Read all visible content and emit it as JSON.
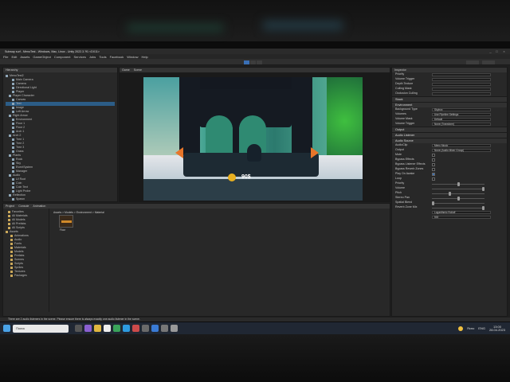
{
  "window": {
    "title": "Subway surf - MenuTest - Windows, Mac, Linux - Unity 2022.3.?f1 <DX11>"
  },
  "menu": [
    "File",
    "Edit",
    "Assets",
    "GameObject",
    "Component",
    "Services",
    "Jobs",
    "Tools",
    "Facebook",
    "Window",
    "Help"
  ],
  "hierarchy": {
    "tab": "Hierarchy",
    "rows": [
      "MenuTest2",
      "Main Camera",
      "Camera",
      "Directional Light",
      "Player",
      "Player Character",
      "Canvas",
      "Text",
      "Image",
      "Left Arrow",
      "Right Arrow",
      "Environment",
      "Floor 1",
      "Floor 2",
      "Arch 1",
      "Arch 2",
      "Tree 1",
      "Tree 2",
      "Tree 3",
      "Grass",
      "Plants",
      "Rock",
      "Sky",
      "EventSystem",
      "Manager",
      "Audio",
      "UI Root",
      "Coin",
      "Coin Text",
      "Light Probe",
      "Reflection",
      "Spawn"
    ]
  },
  "scene_tabs": [
    "Game",
    "Scene"
  ],
  "project": {
    "tabs": [
      "Project",
      "Console",
      "Animation"
    ],
    "breadcrumb": "Assets > Models > Environment > Material",
    "folders": [
      "Favorites",
      "All Materials",
      "All Models",
      "All Prefabs",
      "All Scripts",
      "Assets",
      "Animations",
      "Audio",
      "Fonts",
      "Materials",
      "Models",
      "Prefabs",
      "Scenes",
      "Scripts",
      "Sprites",
      "Textures",
      "Packages"
    ],
    "asset_label": "Floor"
  },
  "game": {
    "coin_value": "90$"
  },
  "inspector": {
    "tab": "Inspector",
    "top_rows": [
      "Priority",
      "Volume Trigger",
      "Depth Texture",
      "Culling Mask",
      "Occlusion Culling"
    ],
    "sections": [
      "Stack",
      "Environment",
      "Output",
      "Audio Listener",
      "Audio Source"
    ],
    "env_rows": [
      "Background Type",
      "Volumes",
      "Volume Mask",
      "Volume Trigger"
    ],
    "env_values": [
      "Skybox",
      "Use Pipeline Settings",
      "Default",
      "None (Transform)"
    ],
    "audio_rows": [
      "AudioClip",
      "Output",
      "Mute",
      "Bypass Effects",
      "Bypass Listener Effects",
      "Bypass Reverb Zones",
      "Play On Awake",
      "Loop",
      "Priority",
      "Volume",
      "Pitch",
      "Stereo Pan",
      "Spatial Blend",
      "Reverb Zone Mix"
    ],
    "audio_values": [
      "Menu Music",
      "None (Audio Mixer Group)"
    ],
    "sliders": [
      0.5,
      1.0,
      0.33,
      0.5,
      0.0,
      1.0
    ],
    "rolloff": "Logarithmic Rolloff",
    "min_label": "500"
  },
  "status": {
    "text": "There are 2 audio listeners in the scene. Please ensure there is always exactly one audio listener in the scene."
  },
  "taskbar": {
    "search": "Поиск",
    "weather": "Ясно",
    "lang": "ENG",
    "time": "13:00",
    "date": "28.04.2023"
  }
}
